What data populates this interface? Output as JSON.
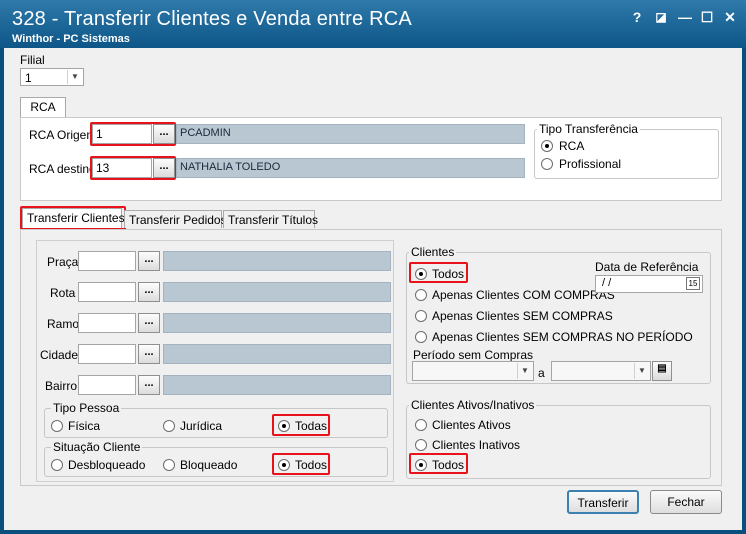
{
  "window": {
    "title": "328 - Transferir  Clientes e Venda entre RCA",
    "subtitle": "Winthor - PC Sistemas",
    "buttons": {
      "help": "?",
      "edit": "◪",
      "minimize": "—",
      "maximize": "☐",
      "close": "✕"
    }
  },
  "filial": {
    "label": "Filial",
    "value": "1"
  },
  "rca_tab": {
    "label": "RCA"
  },
  "rca_origem": {
    "label": "RCA Origem",
    "code": "1",
    "name": "PCADMIN"
  },
  "rca_destino": {
    "label": "RCA destino",
    "code": "13",
    "name": "NATHALIA TOLEDO"
  },
  "lookup_btn": "...",
  "tipo_transferencia": {
    "title": "Tipo Transferência",
    "options": [
      "RCA",
      "Profissional"
    ],
    "selected": "RCA"
  },
  "tabs": [
    "Transferir Clientes",
    "Transferir Pedidos",
    "Transferir Títulos"
  ],
  "filters": {
    "praca": "Praça",
    "rota": "Rota",
    "ramo": "Ramo",
    "cidade": "Cidade",
    "bairro": "Bairro"
  },
  "tipo_pessoa": {
    "title": "Tipo Pessoa",
    "options": [
      "Física",
      "Jurídica",
      "Todas"
    ],
    "selected": "Todas"
  },
  "situacao_cliente": {
    "title": "Situação Cliente",
    "options": [
      "Desbloqueado",
      "Bloqueado",
      "Todos"
    ],
    "selected": "Todos"
  },
  "clientes": {
    "title": "Clientes",
    "options": [
      "Todos",
      "Apenas Clientes COM COMPRAS",
      "Apenas Clientes SEM COMPRAS",
      "Apenas Clientes SEM COMPRAS NO PERÍODO"
    ],
    "selected": "Todos",
    "data_referencia_label": "Data de Referência",
    "data_referencia_value": " /  /",
    "periodo_label": "Período sem Compras",
    "periodo_sep": "a"
  },
  "clientes_ativos": {
    "title": "Clientes Ativos/Inativos",
    "options": [
      "Clientes Ativos",
      "Clientes Inativos",
      "Todos"
    ],
    "selected": "Todos"
  },
  "actions": {
    "transferir": "Transferir",
    "fechar": "Fechar"
  },
  "colors": {
    "titlebar": "#0d5687",
    "highlight": "#e8121b",
    "readonly": "#b9c7d3"
  }
}
